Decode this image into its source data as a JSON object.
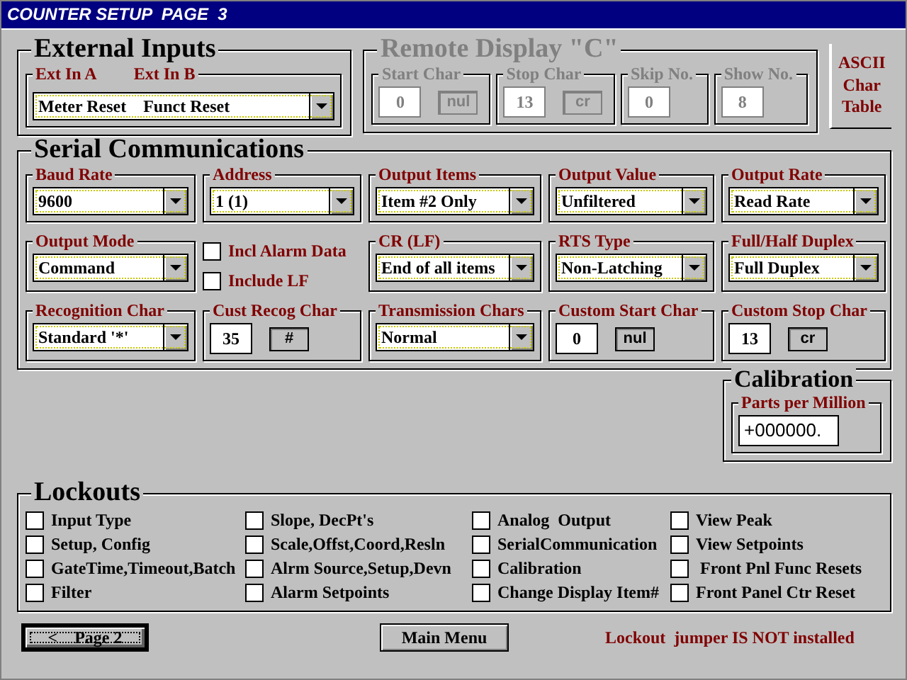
{
  "window": {
    "title": "COUNTER SETUP  PAGE  3"
  },
  "external_inputs": {
    "title": "External Inputs",
    "labels": [
      "Ext In A",
      "Ext In B"
    ],
    "values": [
      "Meter Reset",
      "Funct Reset"
    ]
  },
  "remote_display": {
    "title": "Remote Display \"C\"",
    "disabled": true,
    "fields": [
      {
        "label": "Start Char",
        "value": "0",
        "char": "nul"
      },
      {
        "label": "Stop Char",
        "value": "13",
        "char": "cr"
      },
      {
        "label": "Skip No.",
        "value": "0"
      },
      {
        "label": "Show No.",
        "value": "8"
      }
    ]
  },
  "ascii_button": {
    "label": "ASCII Char Table"
  },
  "serial": {
    "title": "Serial Communications",
    "groups": [
      {
        "kind": "dropdown",
        "label": "Baud Rate",
        "value": "9600"
      },
      {
        "kind": "dropdown",
        "label": "Address",
        "value": "1 (1)"
      },
      {
        "kind": "dropdown",
        "label": "Output Items",
        "value": "Item #2 Only"
      },
      {
        "kind": "dropdown",
        "label": "Output Value",
        "value": "Unfiltered"
      },
      {
        "kind": "dropdown",
        "label": "Output Rate",
        "value": "Read Rate"
      },
      {
        "kind": "dropdown",
        "label": "Output Mode",
        "value": "Command"
      },
      {
        "kind": "checkboxes",
        "items": [
          {
            "label": "Incl Alarm Data",
            "checked": false
          },
          {
            "label": "Include LF",
            "checked": false
          }
        ]
      },
      {
        "kind": "dropdown",
        "label": "CR (LF)",
        "value": "End of all items"
      },
      {
        "kind": "dropdown",
        "label": "RTS Type",
        "value": "Non-Latching"
      },
      {
        "kind": "dropdown",
        "label": "Full/Half Duplex",
        "value": "Full Duplex"
      },
      {
        "kind": "dropdown",
        "label": "Recognition Char",
        "value": "Standard '*'"
      },
      {
        "kind": "char",
        "label": "Cust Recog Char",
        "value": "35",
        "char": "#"
      },
      {
        "kind": "dropdown",
        "label": "Transmission Chars",
        "value": "Normal"
      },
      {
        "kind": "char",
        "label": "Custom Start Char",
        "value": "0",
        "char": "nul"
      },
      {
        "kind": "char",
        "label": "Custom Stop Char",
        "value": "13",
        "char": "cr"
      }
    ]
  },
  "calibration": {
    "title": "Calibration",
    "label": "Parts per Million",
    "value": "+000000."
  },
  "lockouts": {
    "title": "Lockouts",
    "items": [
      {
        "label": "Input Type",
        "checked": false
      },
      {
        "label": "Setup, Config",
        "checked": false
      },
      {
        "label": "GateTime,Timeout,Batch",
        "checked": false
      },
      {
        "label": "Filter",
        "checked": false
      },
      {
        "label": "Slope, DecPt's",
        "checked": false
      },
      {
        "label": "Scale,Offst,Coord,Resln",
        "checked": false
      },
      {
        "label": "Alrm Source,Setup,Devn",
        "checked": false
      },
      {
        "label": "Alarm Setpoints",
        "checked": false
      },
      {
        "label": "Analog  Output",
        "checked": false
      },
      {
        "label": "SerialCommunication",
        "checked": false
      },
      {
        "label": "Calibration",
        "checked": false
      },
      {
        "label": "Change Display Item#",
        "checked": false
      },
      {
        "label": "View Peak",
        "checked": false
      },
      {
        "label": "View Setpoints",
        "checked": false
      },
      {
        "label": " Front Pnl Func Resets",
        "checked": false
      },
      {
        "label": "Front Panel Ctr Reset",
        "checked": false
      }
    ]
  },
  "buttons": [
    {
      "label": "<    Page 2",
      "focused": true
    },
    {
      "label": "Main Menu",
      "focused": false
    }
  ],
  "status": "Lockout  jumper IS NOT installed"
}
